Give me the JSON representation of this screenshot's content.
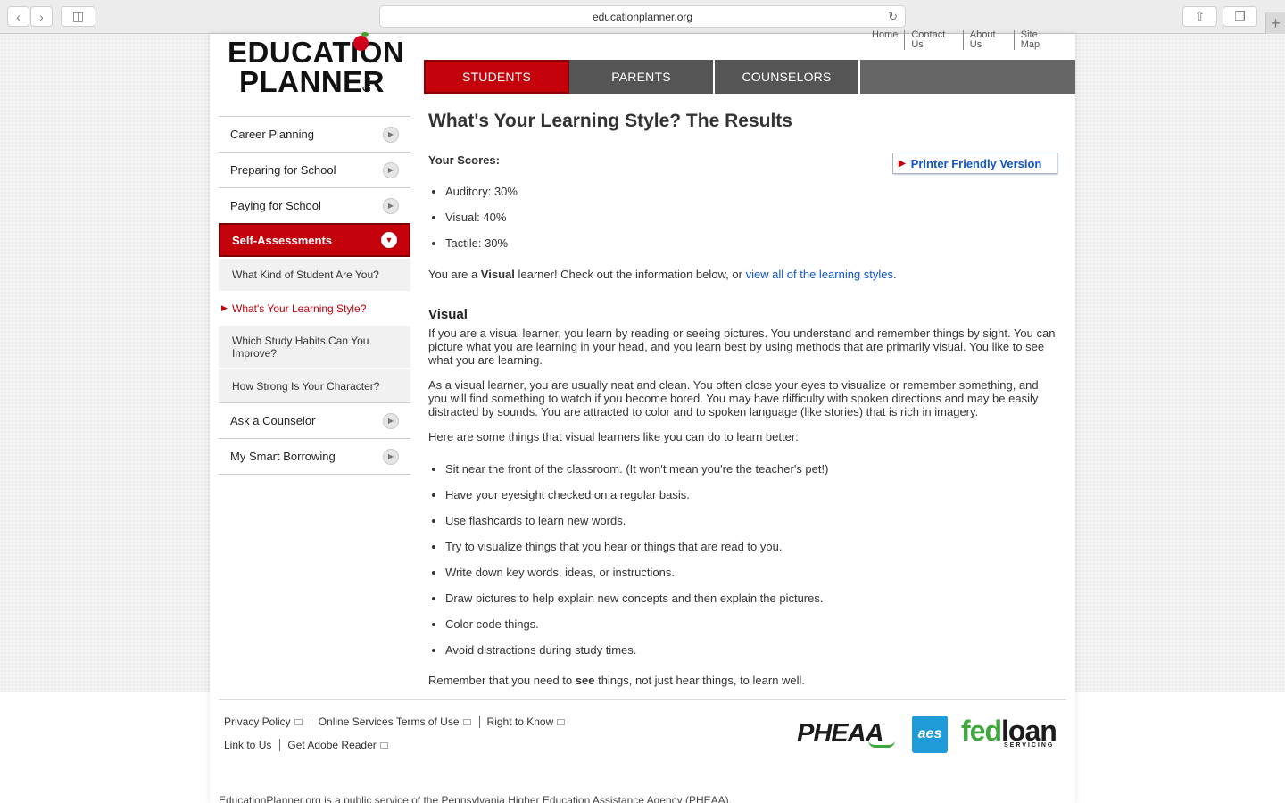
{
  "browser": {
    "url": "educationplanner.org"
  },
  "logo": {
    "line1": "EDUCATION",
    "line2": "PLANNER",
    "suffix": ".org"
  },
  "top_links": [
    "Home",
    "Contact Us",
    "About Us",
    "Site Map"
  ],
  "tabs": [
    {
      "label": "STUDENTS",
      "active": true
    },
    {
      "label": "PARENTS",
      "active": false
    },
    {
      "label": "COUNSELORS",
      "active": false
    }
  ],
  "sidebar": {
    "items_top": [
      "Career Planning",
      "Preparing for School",
      "Paying for School"
    ],
    "active_item": "Self-Assessments",
    "sub_items": [
      "What Kind of Student Are You?",
      "What's Your Learning Style?",
      "Which Study Habits Can You Improve?",
      "How Strong Is Your Character?"
    ],
    "items_bottom": [
      "Ask a Counselor",
      "My Smart Borrowing"
    ]
  },
  "main": {
    "title": "What's Your Learning Style? The Results",
    "scores_label": "Your Scores:",
    "printer_label": "Printer Friendly Version",
    "scores": [
      "Auditory: 30%",
      "Visual: 40%",
      "Tactile: 30%"
    ],
    "learner_pre": "You are a ",
    "learner_bold": "Visual",
    "learner_mid": " learner! Check out the information below, or ",
    "learner_link": "view all of the learning styles",
    "learner_end": ".",
    "section_heading": "Visual",
    "paragraph1": "If you are a visual learner, you learn by reading or seeing pictures. You understand and remember things by sight. You can picture what you are learning in your head, and you learn best by using methods that are primarily visual. You like to see what you are learning.",
    "paragraph2": "As a visual learner, you are usually neat and clean. You often close your eyes to visualize or remember something, and you will find something to watch if you become bored. You may have difficulty with spoken directions and may be easily distracted by sounds. You are attracted to color and to spoken language (like stories) that is rich in imagery.",
    "paragraph3": "Here are some things that visual learners like you can do to learn better:",
    "tips": [
      "Sit near the front of the classroom. (It won't mean you're the teacher's pet!)",
      "Have your eyesight checked on a regular basis.",
      "Use flashcards to learn new words.",
      "Try to visualize things that you hear or things that are read to you.",
      "Write down key words, ideas, or instructions.",
      "Draw pictures to help explain new concepts and then explain the pictures.",
      "Color code things.",
      "Avoid distractions during study times."
    ],
    "remember_pre": "Remember that you need to ",
    "remember_bold": "see",
    "remember_end": " things, not just hear things, to learn well."
  },
  "footer": {
    "links_row1": [
      "Privacy Policy",
      "Online Services Terms of Use",
      "Right to Know"
    ],
    "links_row2": [
      "Link to Us",
      "Get Adobe Reader"
    ],
    "logo_pheaa": "PHEAA",
    "logo_aes": "aes",
    "logo_fedloan_a": "fed",
    "logo_fedloan_b": "loan",
    "logo_servicing": "SERVICING",
    "public_service": "EducationPlanner.org is a public service of the Pennsylvania Higher Education Assistance Agency (PHEAA)."
  }
}
